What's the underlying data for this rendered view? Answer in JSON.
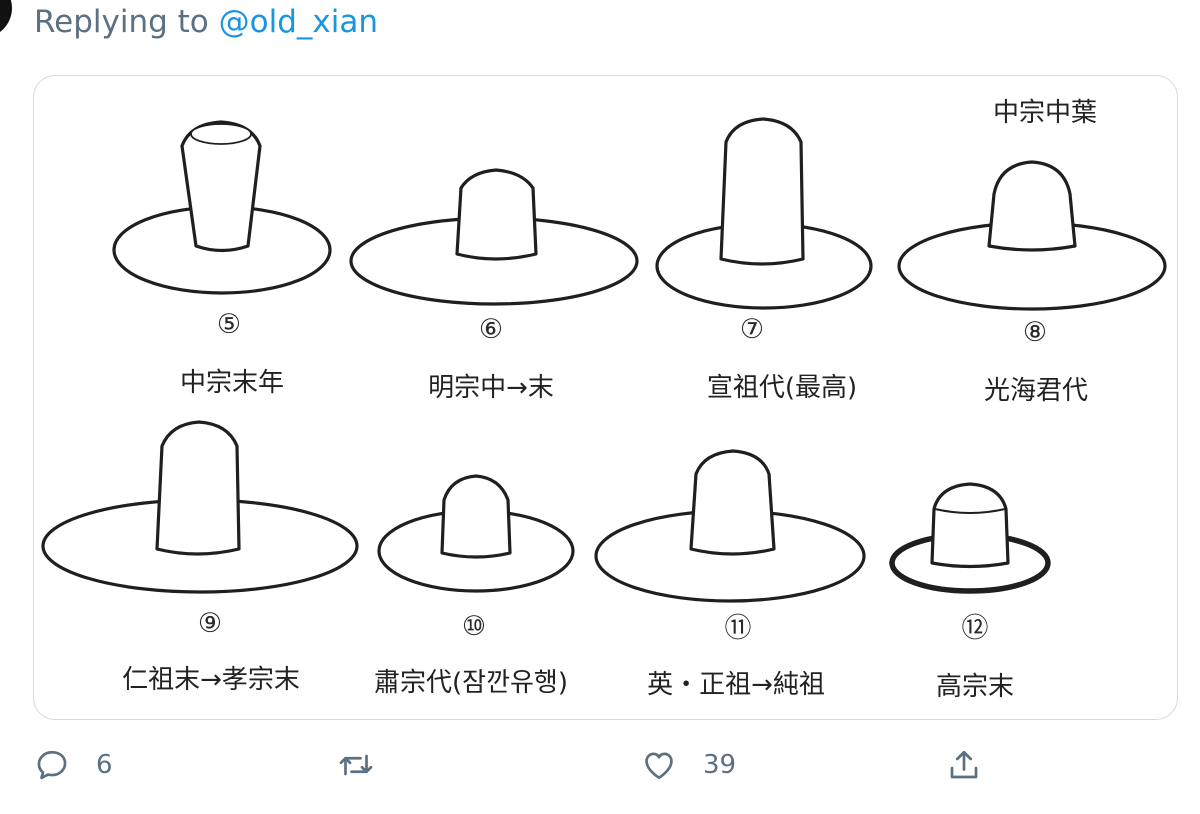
{
  "reply": {
    "prefix": "Replying to",
    "handle": "@old_xian"
  },
  "image": {
    "header": "中宗中葉",
    "hats": [
      {
        "num": "⑤",
        "label": "中宗末年"
      },
      {
        "num": "⑥",
        "label": "明宗中→末"
      },
      {
        "num": "⑦",
        "label": "宣祖代(最高)"
      },
      {
        "num": "⑧",
        "label": "光海君代"
      },
      {
        "num": "⑨",
        "label": "仁祖末→孝宗末"
      },
      {
        "num": "⑩",
        "label": "肅宗代(잠깐유행)"
      },
      {
        "num": "⑪",
        "label": "英・正祖→純祖"
      },
      {
        "num": "⑫",
        "label": "高宗末"
      }
    ]
  },
  "actions": {
    "reply": {
      "icon": "reply-icon",
      "count": "6"
    },
    "retweet": {
      "icon": "retweet-icon",
      "count": ""
    },
    "like": {
      "icon": "heart-icon",
      "count": "39"
    },
    "share": {
      "icon": "share-icon",
      "count": ""
    }
  }
}
